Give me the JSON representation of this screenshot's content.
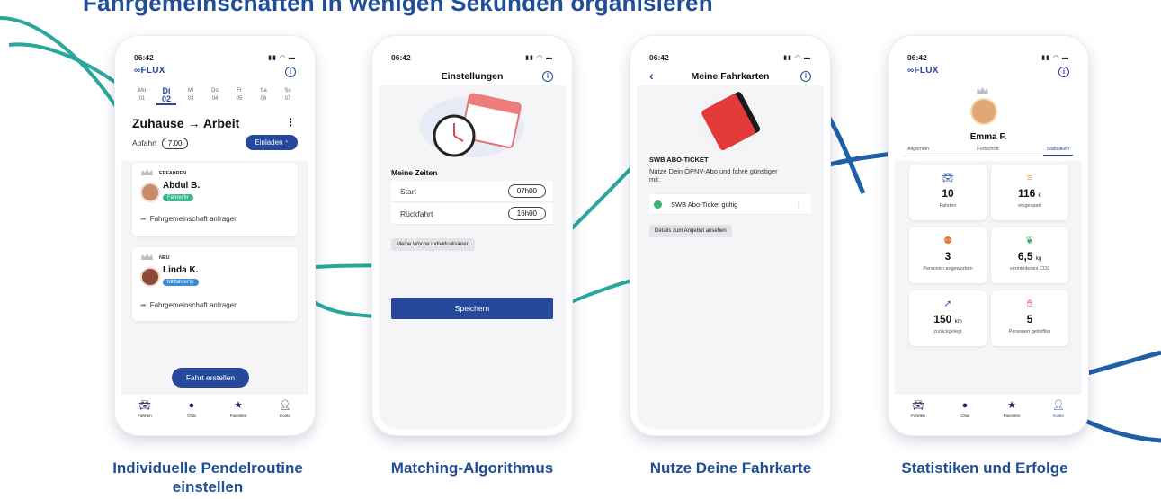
{
  "headline": "Fahrgemeinschaften in wenigen Sekunden organisieren",
  "colors": {
    "brand": "#25489a",
    "accent_teal": "#2aa79b",
    "accent_navy": "#1f5fa8"
  },
  "captions": [
    "Individuelle Pendelroutine einstellen",
    "Matching-Algorithmus",
    "Nutze Deine Fahrkarte",
    "Statistiken und Erfolge"
  ],
  "phone1": {
    "time": "06:42",
    "brand": "FLUX",
    "days": [
      {
        "name": "Mo",
        "num": "01"
      },
      {
        "name": "Di",
        "num": "02"
      },
      {
        "name": "Mi",
        "num": "03"
      },
      {
        "name": "Do",
        "num": "04"
      },
      {
        "name": "Fr",
        "num": "05"
      },
      {
        "name": "Sa",
        "num": "06"
      },
      {
        "name": "So",
        "num": "07"
      }
    ],
    "selected_day_index": 1,
    "route": "Zuhause → Arbeit",
    "departure_label": "Abfahrt",
    "departure_time": "7.00",
    "invite": "Einladen",
    "cards": [
      {
        "tag": "ERFAHREN",
        "name": "Abdul B.",
        "badge": "Fahrer'in",
        "badge_color": "#3db58f",
        "action": "Fahrgemeinschaft anfragen"
      },
      {
        "tag": "NEU",
        "name": "Linda K.",
        "badge": "Mitfahrer'in",
        "badge_color": "#3b8bd6",
        "action": "Fahrgemeinschaft anfragen"
      }
    ],
    "create_button": "Fahrt erstellen"
  },
  "nav": [
    "Fahrten",
    "Chat",
    "Favoriten",
    "Konto"
  ],
  "phone2": {
    "time": "06:42",
    "title": "Einstellungen",
    "section": "Meine Zeiten",
    "rows": [
      {
        "label": "Start",
        "value": "07h00"
      },
      {
        "label": "Rückfahrt",
        "value": "16h00"
      }
    ],
    "chip": "Meine Woche individualisieren",
    "save": "Speichern"
  },
  "phone3": {
    "time": "06:42",
    "title": "Meine Fahrkarten",
    "ticket_title": "SWB ABO-TICKET",
    "ticket_desc": "Nutze Dein ÖPNV-Abo und fahre günstiger mit.",
    "status": "SWB Abo-Ticket gültig",
    "chip": "Details zum Angebot ansehen"
  },
  "phone4": {
    "time": "06:42",
    "brand": "FLUX",
    "name": "Emma F.",
    "tabs": [
      "Allgemein",
      "Fortschritt",
      "Statistiken"
    ],
    "active_tab_index": 2,
    "stats": [
      {
        "icon": "car-icon",
        "value": "10",
        "unit": "",
        "label": "Fahrten"
      },
      {
        "icon": "coins-icon",
        "value": "116",
        "unit": "€",
        "label": "eingespart"
      },
      {
        "icon": "people-icon",
        "value": "3",
        "unit": "",
        "label": "Personen angeworben"
      },
      {
        "icon": "leaf-icon",
        "value": "6,5",
        "unit": "kg",
        "label": "vermiedenes CO2"
      },
      {
        "icon": "rocket-icon",
        "value": "150",
        "unit": "km",
        "label": "zurückgelegt"
      },
      {
        "icon": "wave-icon",
        "value": "5",
        "unit": "",
        "label": "Personen getroffen"
      }
    ]
  }
}
